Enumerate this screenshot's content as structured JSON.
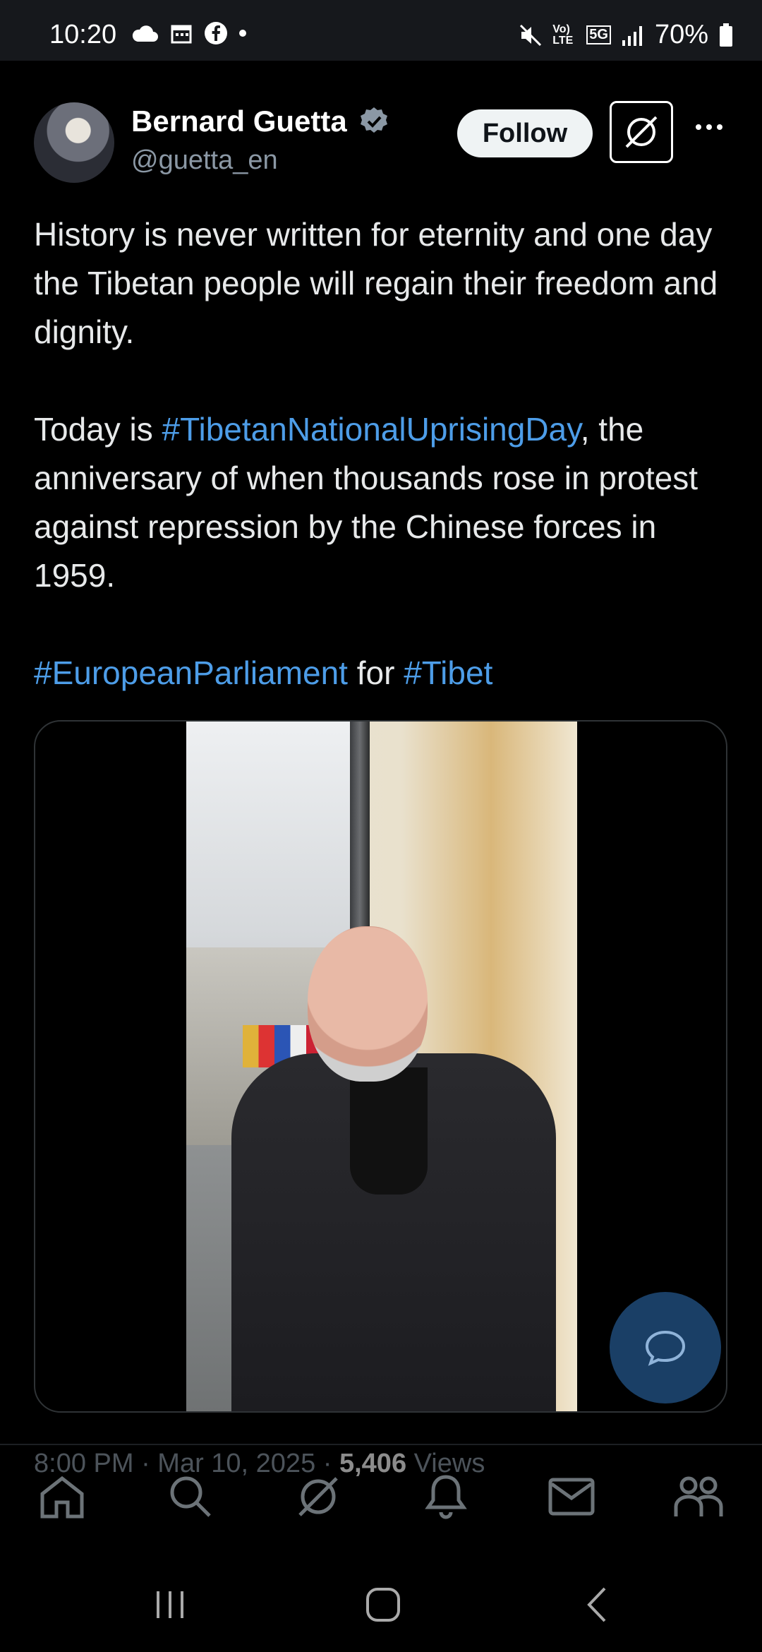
{
  "status_bar": {
    "time": "10:20",
    "battery": "70%",
    "network": "5G",
    "lte_label": "Vo) LTE"
  },
  "tweet": {
    "author_name": "Bernard Guetta",
    "author_handle": "@guetta_en",
    "follow_label": "Follow",
    "text_part1": "History is never written for eternity and one day the Tibetan people will regain their freedom and dignity.\n\nToday is ",
    "hashtag1": "#TibetanNationalUprisingDay",
    "text_part2": ", the anniversary of when thousands rose in protest against repression by the Chinese forces in 1959.\n\n",
    "hashtag2": "#EuropeanParliament",
    "text_part3": " for ",
    "hashtag3": "#Tibet",
    "timestamp": "8:00 PM · Mar 10, 2025 · ",
    "views_count": "5,406",
    "views_label": " Views"
  },
  "bottom_nav": {
    "items": [
      "home-icon",
      "search-icon",
      "grok-icon",
      "notifications-icon",
      "messages-icon",
      "communities-icon"
    ]
  },
  "colors": {
    "hashtag": "#4d9de8",
    "background": "#000000",
    "fab": "#1a3f66"
  }
}
